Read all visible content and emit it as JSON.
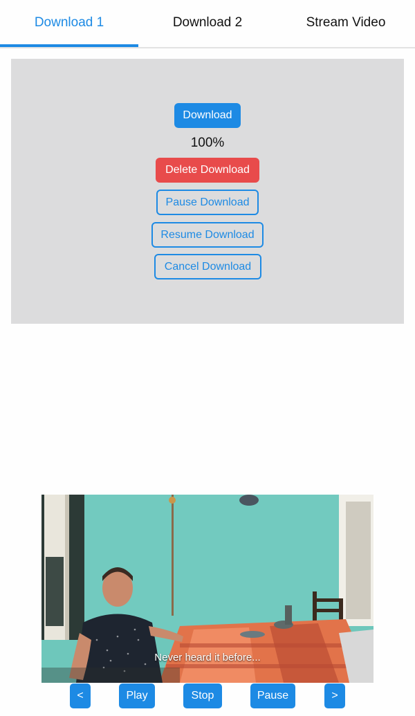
{
  "tabs": [
    {
      "label": "Download 1",
      "active": true
    },
    {
      "label": "Download 2",
      "active": false
    },
    {
      "label": "Stream Video",
      "active": false
    }
  ],
  "download_panel": {
    "download_label": "Download",
    "progress_text": "100%",
    "delete_label": "Delete Download",
    "pause_label": "Pause Download",
    "resume_label": "Resume Download",
    "cancel_label": "Cancel Download"
  },
  "video": {
    "subtitle": "Never heard it before..."
  },
  "controls": {
    "prev_label": "<",
    "play_label": "Play",
    "stop_label": "Stop",
    "pause_label": "Pause",
    "next_label": ">"
  },
  "colors": {
    "accent": "#1d8ae4",
    "danger": "#e84b4b",
    "panel_bg": "#dcdcdd"
  }
}
